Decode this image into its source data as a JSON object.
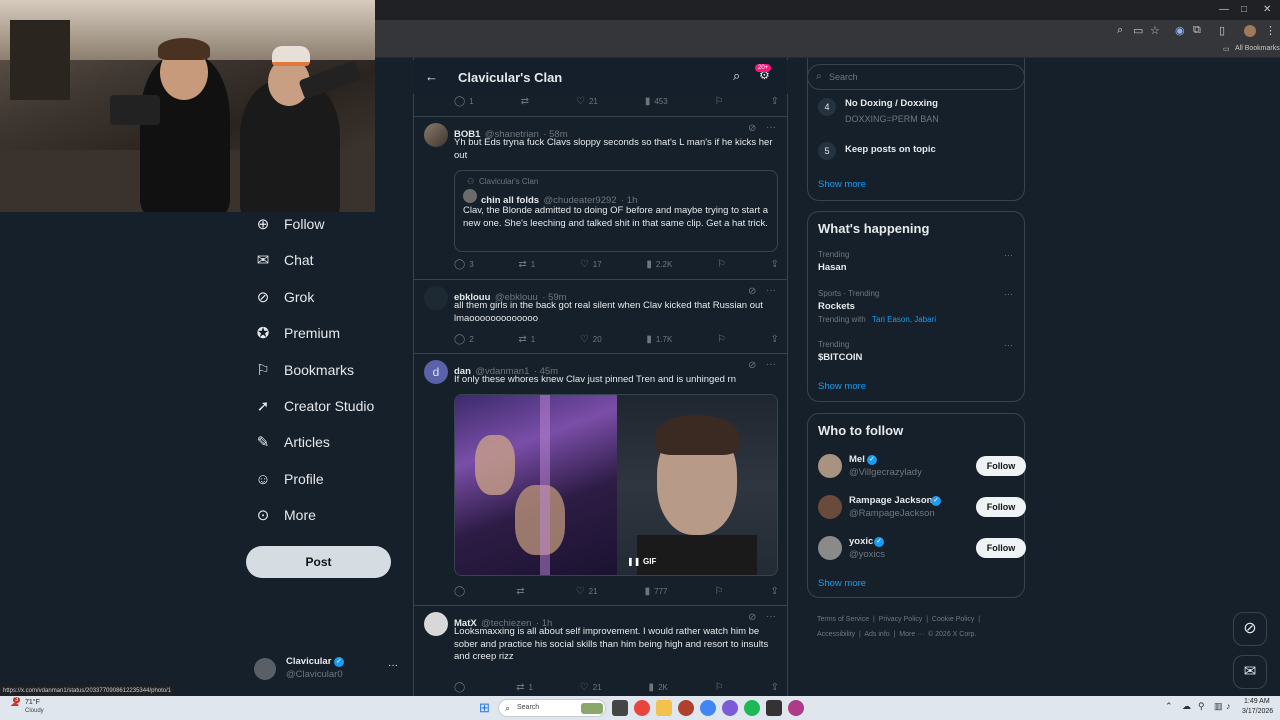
{
  "browser": {
    "bookmarks_label": "All Bookmarks",
    "status_url": "https://x.com/vdanman1/status/2033770908612235344/photo/1",
    "window_controls": [
      "—",
      "□",
      "✕"
    ]
  },
  "sidebar": {
    "items": [
      {
        "label": "Follow",
        "icon": "follow-icon"
      },
      {
        "label": "Chat",
        "icon": "mail-icon"
      },
      {
        "label": "Grok",
        "icon": "grok-icon"
      },
      {
        "label": "Premium",
        "icon": "premium-icon"
      },
      {
        "label": "Bookmarks",
        "icon": "bookmark-icon"
      },
      {
        "label": "Creator Studio",
        "icon": "rocket-icon"
      },
      {
        "label": "Articles",
        "icon": "article-icon"
      },
      {
        "label": "Profile",
        "icon": "profile-icon"
      },
      {
        "label": "More",
        "icon": "more-icon"
      }
    ],
    "post_label": "Post",
    "account": {
      "name": "Clavicular",
      "handle": "@Clavicular0",
      "more": "···"
    }
  },
  "feed": {
    "title": "Clavicular's Clan",
    "notif_badge": "20+",
    "top_actions": {
      "replies": "1",
      "reposts": "",
      "likes": "21",
      "views": "453"
    },
    "tweets": [
      {
        "name": "BOB1",
        "handle": "@shanetrian",
        "time": "· 58m",
        "text": "Yh but Eds tryna fuck Clavs sloppy seconds so that's L man's if he kicks her out",
        "quote": {
          "community": "Clavicular's Clan",
          "name": "chin all folds",
          "handle": "@chudeater9292",
          "time": "· 1h",
          "text": "Clav, the Blonde admitted to doing OF before and maybe trying to start a new one. She's leeching and talked shit in that same clip. Get a hat trick."
        },
        "actions": {
          "replies": "3",
          "reposts": "1",
          "likes": "17",
          "views": "2.2K"
        }
      },
      {
        "name": "ebklouu",
        "handle": "@ebklouu",
        "time": "· 59m",
        "text": "all them girls in the back got real silent when Clav kicked that Russian out lmaooooooooooooo",
        "actions": {
          "replies": "2",
          "reposts": "1",
          "likes": "20",
          "views": "1.7K"
        }
      },
      {
        "name": "dan",
        "handle": "@vdanman1",
        "time": "· 45m",
        "avatar_letter": "d",
        "text": "If only these whores knew Clav just pinned Tren and is unhinged rn",
        "media_label": "GIF",
        "actions": {
          "replies": "",
          "reposts": "",
          "likes": "21",
          "views": "777"
        }
      },
      {
        "name": "MatX",
        "handle": "@techiezen",
        "time": "· 1h",
        "text": "Looksmaxxing is all about self improvement. I would rather watch him be sober and practice his social skills than him being high and resort to insults and creep rizz",
        "actions": {
          "replies": "",
          "reposts": "1",
          "likes": "21",
          "views": "2K"
        }
      }
    ]
  },
  "right": {
    "search_placeholder": "Search",
    "rules": [
      {
        "num": "4",
        "title": "No Doxing / Doxxing",
        "desc": "DOXXING=PERM BAN"
      },
      {
        "num": "5",
        "title": "Keep posts on topic",
        "desc": ""
      }
    ],
    "rules_show_more": "Show more",
    "happening": {
      "title": "What's happening",
      "trends": [
        {
          "context": "Trending",
          "name": "Hasan",
          "with": "",
          "with_names": ""
        },
        {
          "context": "Sports · Trending",
          "name": "Rockets",
          "with": "Trending with",
          "with_names": "Tari Eason, Jabari"
        },
        {
          "context": "Trending",
          "name": "$BITCOIN",
          "with": "",
          "with_names": ""
        }
      ],
      "show_more": "Show more"
    },
    "who_to_follow": {
      "title": "Who to follow",
      "users": [
        {
          "name": "Mel",
          "handle": "@Villgecrazylady",
          "button": "Follow"
        },
        {
          "name": "Rampage Jackson",
          "handle": "@RampageJackson",
          "button": "Follow"
        },
        {
          "name": "yoxic",
          "handle": "@yoxics",
          "button": "Follow"
        }
      ],
      "show_more": "Show more"
    },
    "footer": {
      "line1": [
        "Terms of Service",
        "|",
        "Privacy Policy",
        "|",
        "Cookie Policy",
        "|"
      ],
      "line2": [
        "Accessibility",
        "|",
        "Ads info",
        "|",
        "More ···",
        "© 2026 X Corp."
      ]
    }
  },
  "taskbar": {
    "weather_temp": "71°F",
    "weather_desc": "Cloudy",
    "weather_badge": "3",
    "search_placeholder": "Search",
    "time": "1:49 AM",
    "date": "3/17/2026"
  }
}
